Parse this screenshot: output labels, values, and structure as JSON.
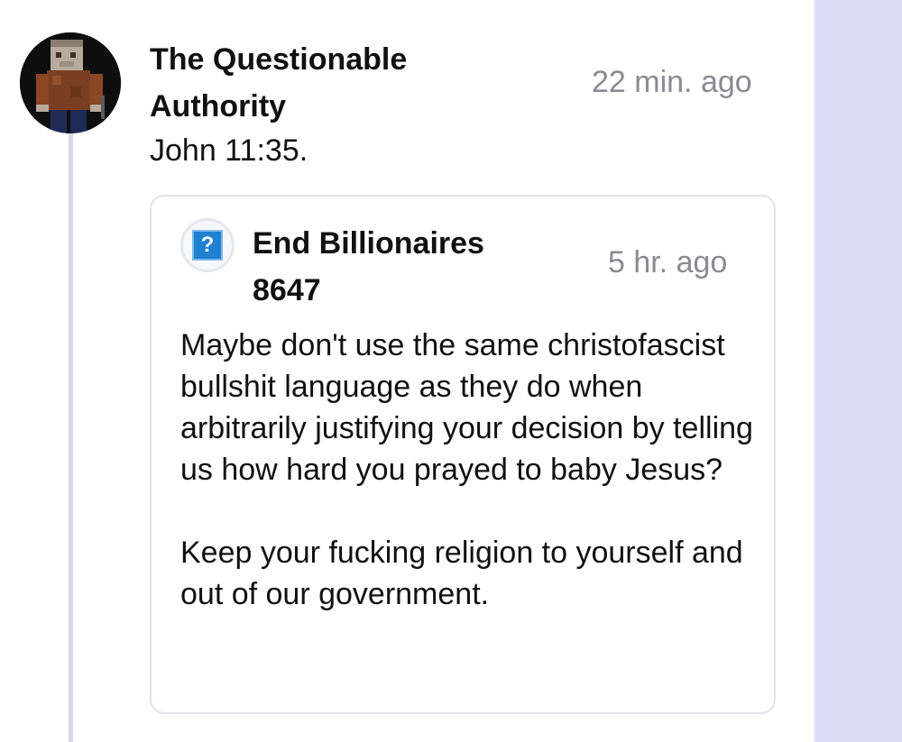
{
  "comment": {
    "author": "The Questionable Authority",
    "timestamp": "22 min. ago",
    "body": "John 11:35."
  },
  "quoted": {
    "author": "End Billionaires 8647",
    "timestamp": "5 hr. ago",
    "avatar_glyph": "?",
    "paragraphs": [
      "Maybe don't use the same christofascist bullshit language as they do when arbitrarily justifying your decision by telling us how hard you prayed to baby Jesus?",
      "Keep your fucking religion to yourself and out of our government."
    ]
  },
  "icons": {
    "main_avatar": "pixel-character-avatar",
    "quoted_avatar": "question-mark-avatar"
  },
  "colors": {
    "rail_background": "#dcdcf7",
    "thread_line": "#d7d7ea",
    "timestamp_text": "#8a8a92",
    "quoted_avatar_box": "#1f7fd0"
  }
}
